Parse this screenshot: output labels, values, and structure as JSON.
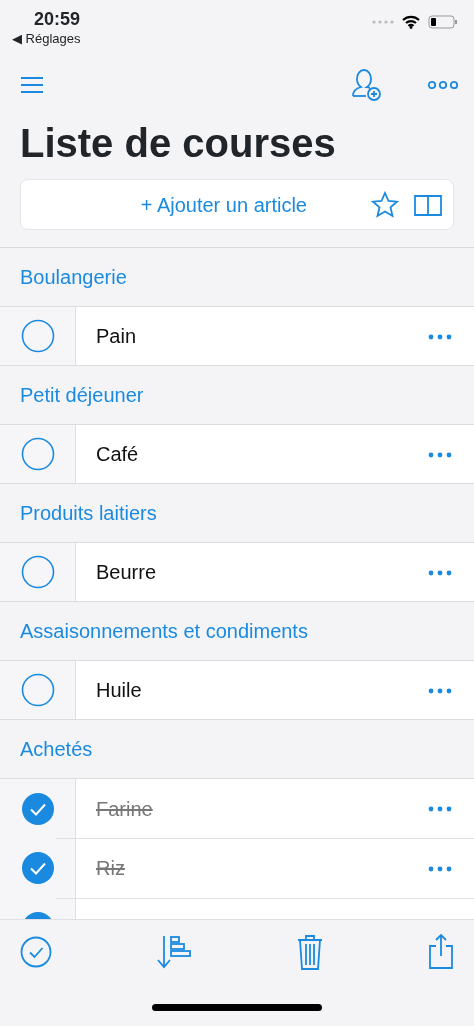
{
  "status_bar": {
    "time": "20:59",
    "back_label": "◀ Réglages"
  },
  "title": "Liste de courses",
  "add_bar": {
    "label": "+ Ajouter un article"
  },
  "sections": [
    {
      "title": "Boulangerie",
      "items": [
        {
          "name": "Pain",
          "checked": false
        }
      ]
    },
    {
      "title": "Petit déjeuner",
      "items": [
        {
          "name": "Café",
          "checked": false
        }
      ]
    },
    {
      "title": "Produits laitiers",
      "items": [
        {
          "name": "Beurre",
          "checked": false
        }
      ]
    },
    {
      "title": "Assaisonnements et condiments",
      "items": [
        {
          "name": "Huile",
          "checked": false
        }
      ]
    },
    {
      "title": "Achetés",
      "items": [
        {
          "name": "Farine",
          "checked": true
        },
        {
          "name": "Riz",
          "checked": true
        },
        {
          "checked": true
        }
      ]
    }
  ]
}
